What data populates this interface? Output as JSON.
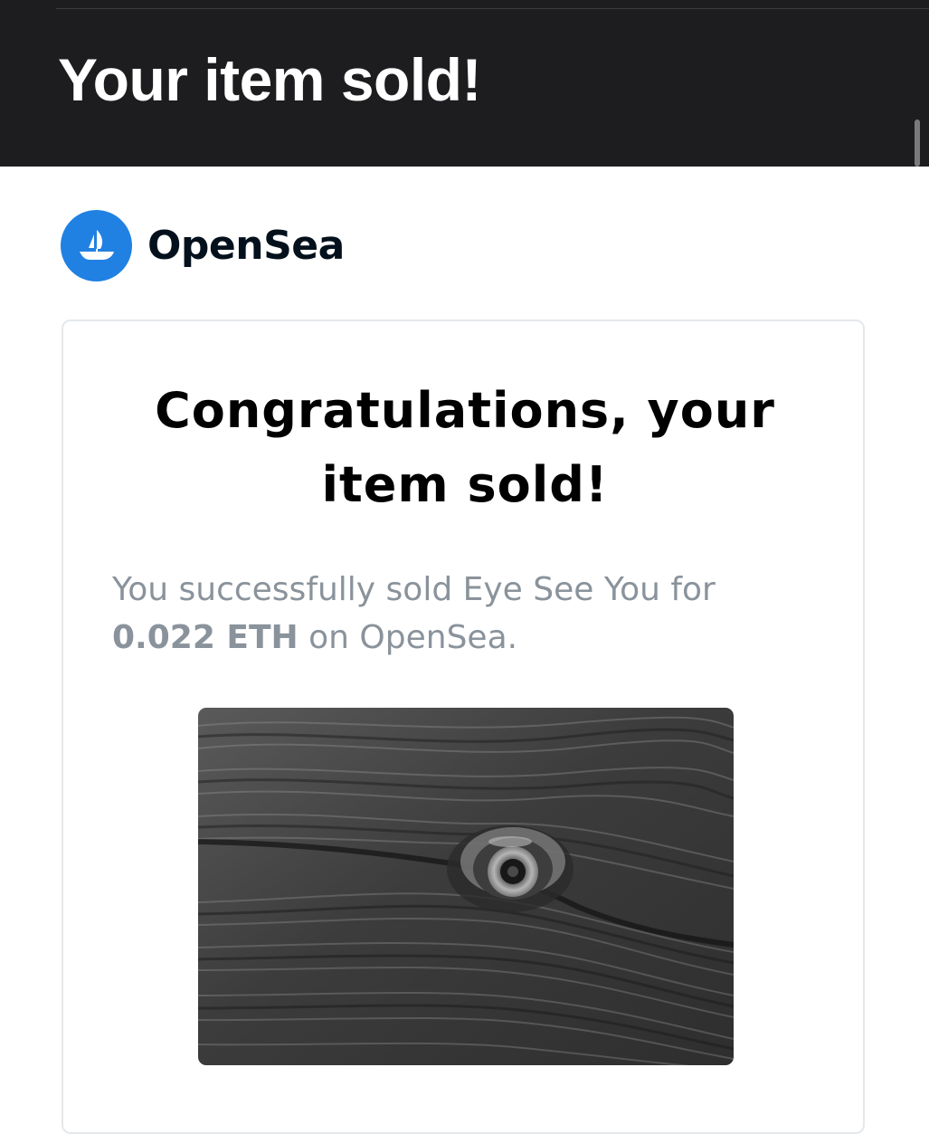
{
  "email": {
    "subject": "Your item sold!"
  },
  "brand": {
    "name": "OpenSea",
    "logo_icon": "opensea-ship-icon",
    "accent_color": "#2081e2"
  },
  "notification": {
    "headline": "Congratulations, your item sold!",
    "message_prefix": "You successfully sold Eye See You for",
    "price": "0.022 ETH",
    "message_suffix": "on OpenSea."
  },
  "nft": {
    "image_description_icon": "wood-eye-artwork-icon"
  }
}
